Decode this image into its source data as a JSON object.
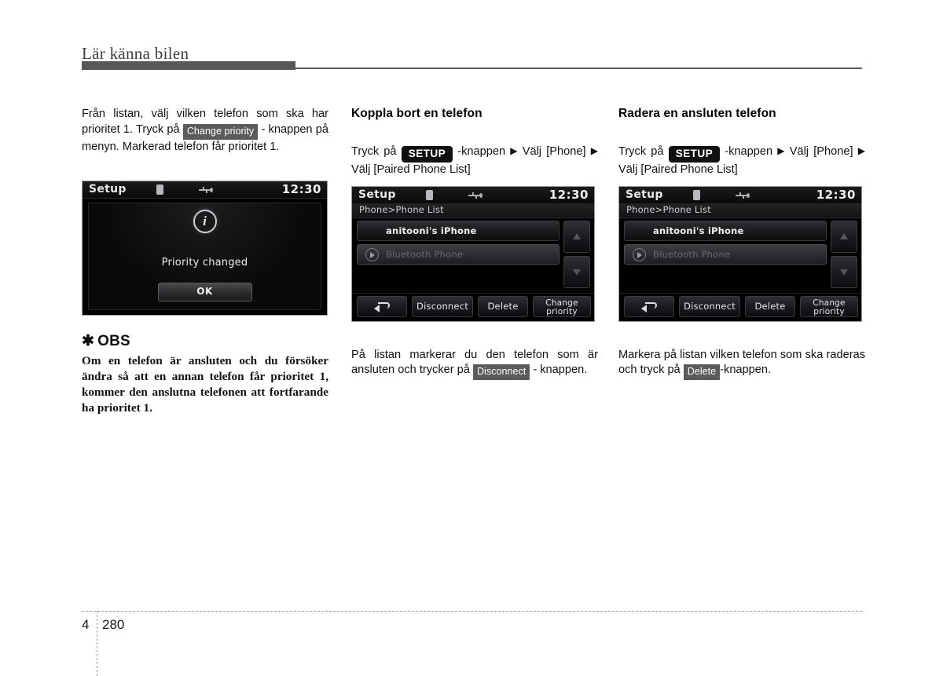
{
  "header": {
    "chapter_title": "Lär känna bilen"
  },
  "columns": {
    "one": {
      "paragraph_pre": "Från listan, välj vilken telefon som ska har prioritet 1. Tryck på",
      "chip_change_priority": "Change priority",
      "paragraph_post": "- knappen på menyn. Markerad telefon får prioritet 1.",
      "note": {
        "star": "✱",
        "title": "OBS",
        "body": "Om en telefon är ansluten och du försöker ändra så att en annan telefon får prioritet 1, kommer den anslutna telefonen att fortfarande ha prioritet 1."
      }
    },
    "two": {
      "section_title": "Koppla bort en telefon",
      "path_pre": "Tryck på",
      "chip_setup": "SETUP",
      "path_mid": "-knappen",
      "arrow": "▶",
      "path_valj": "Välj",
      "path_phone": "[Phone]",
      "path_end": "Välj [Paired Phone List]",
      "caption_pre": "På listan markerar du den telefon som är ansluten och trycker på",
      "caption_chip": "Disconnect",
      "caption_post": "- knappen."
    },
    "three": {
      "section_title": "Radera en ansluten telefon",
      "path_pre": "Tryck på",
      "chip_setup": "SETUP",
      "path_mid": "-knappen",
      "arrow": "▶",
      "path_valj": "Välj",
      "path_phone": "[Phone]",
      "path_end": "Välj [Paired Phone List]",
      "caption_pre": "Markera på listan vilken telefon som ska raderas och tryck på",
      "caption_chip": "Delete",
      "caption_post": "-knappen."
    }
  },
  "screenshots": {
    "dialog": {
      "status_title": "Setup",
      "clock": "12:30",
      "bluetooth_icon": "bluetooth-icon",
      "usb_icon": "usb-icon",
      "info_icon": "i",
      "message": "Priority changed",
      "ok_button": "OK"
    },
    "phone_list_left": {
      "status_title": "Setup",
      "clock": "12:30",
      "breadcrumb": "Phone>Phone List",
      "rows": [
        {
          "label": "anitooni's iPhone",
          "selected": true
        },
        {
          "label": "Bluetooth Phone",
          "selected": false
        }
      ],
      "scroll_up": "scroll-up-icon",
      "scroll_down": "scroll-down-icon",
      "toolbar": {
        "back": "back-arrow-icon",
        "disconnect": "Disconnect",
        "delete": "Delete",
        "change_priority_line1": "Change",
        "change_priority_line2": "priority"
      }
    },
    "phone_list_right": {
      "status_title": "Setup",
      "clock": "12:30",
      "breadcrumb": "Phone>Phone List",
      "rows": [
        {
          "label": "anitooni's iPhone",
          "selected": true
        },
        {
          "label": "Bluetooth Phone",
          "selected": false
        }
      ],
      "scroll_up": "scroll-up-icon",
      "scroll_down": "scroll-down-icon",
      "toolbar": {
        "back": "back-arrow-icon",
        "disconnect": "Disconnect",
        "delete": "Delete",
        "change_priority_line1": "Change",
        "change_priority_line2": "priority"
      }
    }
  },
  "footer": {
    "chapter_number": "4",
    "page_number": "280"
  },
  "colors": {
    "rule": "#58585a",
    "chip_gray": "#5b5b5d",
    "chip_black": "#101010",
    "screen_bg": "#000000"
  }
}
